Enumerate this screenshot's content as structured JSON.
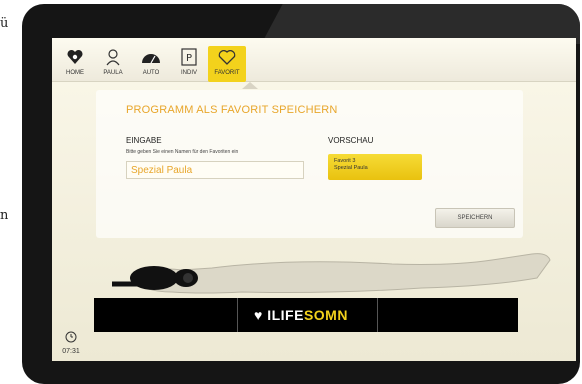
{
  "edge_text": {
    "top": "ü",
    "mid": "n"
  },
  "nav": {
    "items": [
      {
        "label": "HOME",
        "icon": "heart-logo-icon"
      },
      {
        "label": "PAULA",
        "icon": "person-icon"
      },
      {
        "label": "AUTO",
        "icon": "gauge-icon"
      },
      {
        "label": "INDIV",
        "icon": "parking-p-icon"
      },
      {
        "label": "FAVORIT",
        "icon": "heart-outline-icon"
      }
    ],
    "active_index": 4
  },
  "panel": {
    "title": "PROGRAMM ALS FAVORIT SPEICHERN",
    "input_section": "EINGABE",
    "hint": "Bitte geben Sie einen Namen für den Favoriten ein",
    "input_value": "Spezial Paula",
    "preview_section": "VORSCHAU",
    "preview_line1": "Favorit 3",
    "preview_line2": "Spezial Paula",
    "save_label": "SPEICHERN"
  },
  "footer": {
    "logo_prefix": "ILIFE",
    "logo_suffix": "SOMN"
  },
  "clock": {
    "time": "07:31"
  },
  "colors": {
    "accent": "#f3d21c",
    "title": "#e8a62b",
    "bezel": "#151515"
  }
}
